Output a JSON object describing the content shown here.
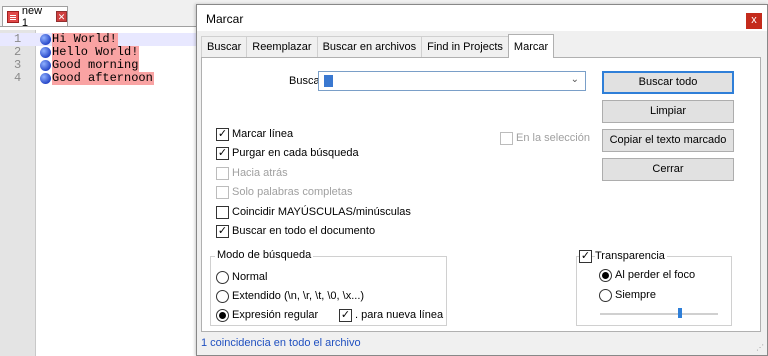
{
  "editor": {
    "tab_label": "new 1",
    "lines": [
      {
        "num": "1",
        "text": "Hi World!"
      },
      {
        "num": "2",
        "text": "Hello World!"
      },
      {
        "num": "3",
        "text": "Good morning"
      },
      {
        "num": "4",
        "text": "Good afternoon"
      }
    ],
    "highlight_color": "#f9a3a3"
  },
  "dialog": {
    "title": "Marcar",
    "close_glyph": "x",
    "tabs": [
      "Buscar",
      "Reemplazar",
      "Buscar en archivos",
      "Find in Projects",
      "Marcar"
    ],
    "active_tab": "Marcar",
    "search_label": "Buscar:",
    "search_value": "",
    "buttons": {
      "find_all": "Buscar todo",
      "clear": "Limpiar",
      "copy_marked": "Copiar el texto marcado",
      "close": "Cerrar"
    },
    "options": {
      "mark_line": {
        "label": "Marcar línea",
        "checked": true
      },
      "purge": {
        "label": "Purgar en cada búsqueda",
        "checked": true
      },
      "backward": {
        "label": "Hacia atrás",
        "checked": false
      },
      "whole_words": {
        "label": "Solo palabras completas",
        "checked": false
      },
      "match_case": {
        "label": "Coincidir MAYÚSCULAS/minúsculas",
        "checked": false
      },
      "wrap": {
        "label": "Buscar en todo el documento",
        "checked": true
      },
      "in_selection": {
        "label": "En la selección",
        "checked": false
      }
    },
    "search_mode": {
      "title": "Modo de búsqueda",
      "normal": "Normal",
      "extended": "Extendido (\\n, \\r, \\t, \\0, \\x...)",
      "regex": "Expresión regular",
      "selected": "regex",
      "dot_newline": {
        "label": ". para nueva línea",
        "checked": true
      }
    },
    "transparency": {
      "label": "Transparencia",
      "checked": true,
      "on_lose_focus": "Al perder el foco",
      "always": "Siempre",
      "selected": "on_lose_focus",
      "level": 0.68
    },
    "status": "1 coincidencia en todo el archivo",
    "accent_color": "#2f7fd8"
  }
}
